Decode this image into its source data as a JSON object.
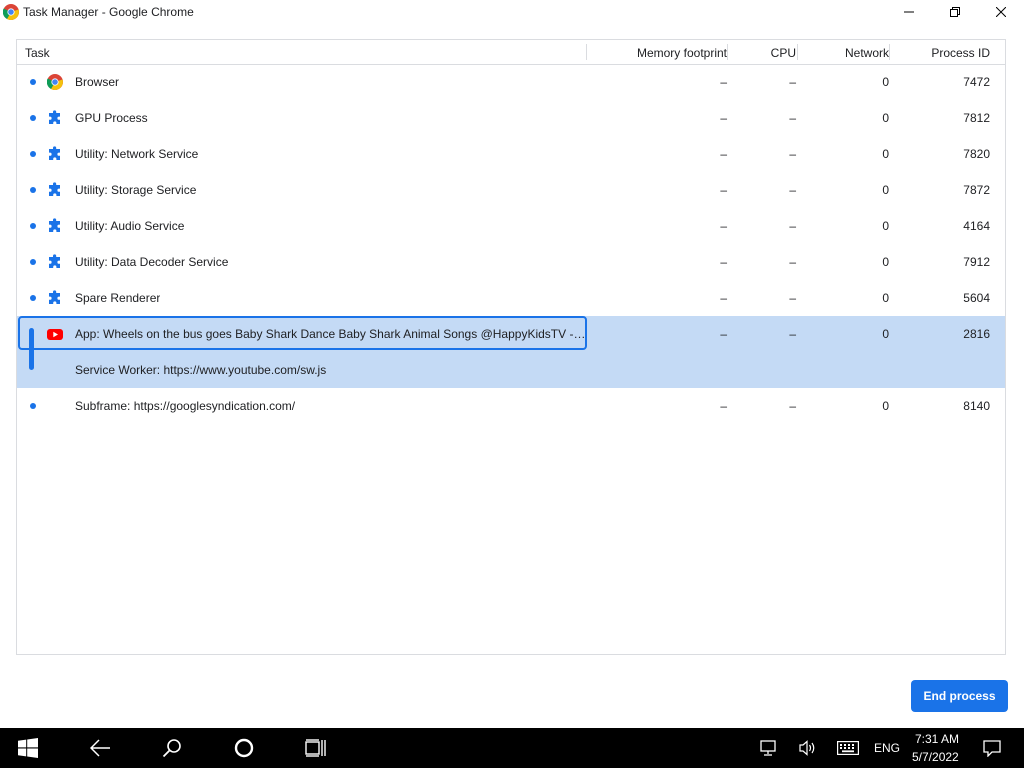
{
  "window": {
    "title": "Task Manager - Google Chrome",
    "icon": "chrome-icon"
  },
  "table": {
    "columns": {
      "task": "Task",
      "memory": "Memory footprint",
      "cpu": "CPU",
      "network": "Network",
      "pid": "Process ID"
    },
    "rows": [
      {
        "icon": "chrome-icon",
        "task": "Browser",
        "memory": "–",
        "cpu": "–",
        "network": "0",
        "pid": "7472"
      },
      {
        "icon": "puzzle-icon",
        "task": "GPU Process",
        "memory": "–",
        "cpu": "–",
        "network": "0",
        "pid": "7812"
      },
      {
        "icon": "puzzle-icon",
        "task": "Utility: Network Service",
        "memory": "–",
        "cpu": "–",
        "network": "0",
        "pid": "7820"
      },
      {
        "icon": "puzzle-icon",
        "task": "Utility: Storage Service",
        "memory": "–",
        "cpu": "–",
        "network": "0",
        "pid": "7872"
      },
      {
        "icon": "puzzle-icon",
        "task": "Utility: Audio Service",
        "memory": "–",
        "cpu": "–",
        "network": "0",
        "pid": "4164"
      },
      {
        "icon": "puzzle-icon",
        "task": "Utility: Data Decoder Service",
        "memory": "–",
        "cpu": "–",
        "network": "0",
        "pid": "7912"
      },
      {
        "icon": "puzzle-icon",
        "task": "Spare Renderer",
        "memory": "–",
        "cpu": "–",
        "network": "0",
        "pid": "5604"
      },
      {
        "icon": "youtube-icon",
        "task": "App: Wheels on the bus goes Baby Shark Dance Baby Shark Animal Songs @HappyKidsTV - Nu...",
        "memory": "–",
        "cpu": "–",
        "network": "0",
        "pid": "2816",
        "selected": true
      },
      {
        "icon": "",
        "task": "Service Worker: https://www.youtube.com/sw.js",
        "memory": "",
        "cpu": "",
        "network": "",
        "pid": "",
        "selected": true
      },
      {
        "icon": "",
        "task": "Subframe: https://googlesyndication.com/",
        "memory": "–",
        "cpu": "–",
        "network": "0",
        "pid": "8140"
      }
    ]
  },
  "actions": {
    "end_process": "End process"
  },
  "taskbar": {
    "language": "ENG",
    "time": "7:31 AM",
    "date": "5/7/2022"
  },
  "colors": {
    "accent": "#1a73e8",
    "selection": "#c4daf5",
    "taskbar": "#000000"
  }
}
